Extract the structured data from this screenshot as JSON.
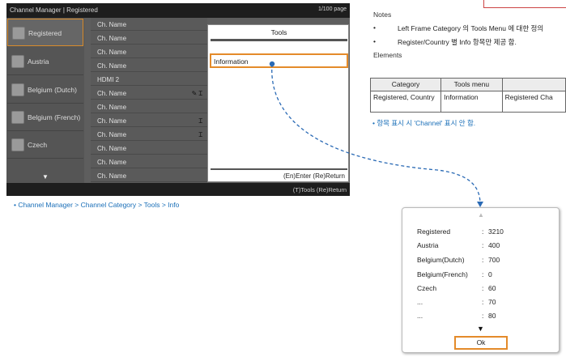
{
  "tv": {
    "title": "Channel Manager | Registered",
    "page_indicator": "1/100 page",
    "categories": [
      {
        "label": "Registered"
      },
      {
        "label": "Austria"
      },
      {
        "label": "Belgium (Dutch)"
      },
      {
        "label": "Belgium (French)"
      },
      {
        "label": "Czech"
      }
    ],
    "more_arrow": "▼",
    "channels": [
      {
        "name": "Ch. Name",
        "icons": ""
      },
      {
        "name": "Ch. Name",
        "icons": ""
      },
      {
        "name": "Ch. Name",
        "icons": ""
      },
      {
        "name": "Ch. Name",
        "icons": ""
      },
      {
        "name": "HDMI 2",
        "icons": ""
      },
      {
        "name": "Ch. Name",
        "icons": "✎ Ɪ"
      },
      {
        "name": "Ch. Name",
        "icons": ""
      },
      {
        "name": "Ch. Name",
        "icons": "Ɪ"
      },
      {
        "name": "Ch. Name",
        "icons": "Ɪ"
      },
      {
        "name": "Ch. Name",
        "icons": ""
      },
      {
        "name": "Ch. Name",
        "icons": ""
      },
      {
        "name": "Ch. Name",
        "icons": ""
      }
    ],
    "footer_keys": "(T)Tools  (Re)Return",
    "tools_popup": {
      "title": "Tools",
      "selected_item": "Information",
      "keys": "(En)Enter  (Re)Return"
    }
  },
  "caption": "• Channel Manager > Channel Category > Tools > Info",
  "notes": {
    "title": "Notes",
    "bullets": [
      "Left Frame Category 의 Tools Menu 에 대한 정의",
      "Register/Country 별  Info  항목만 제공 함."
    ]
  },
  "elements": {
    "title": "Elements",
    "table": {
      "headers": [
        "Category",
        "Tools menu",
        ""
      ],
      "rows": [
        [
          "Registered, Country",
          "Information",
          "Registered Cha"
        ]
      ]
    },
    "note": "•  항목 표시 시 'Channel' 표시 안 함."
  },
  "info_popup": {
    "up_arrow": "▲",
    "rows": [
      {
        "key": "Registered",
        "value": "3210"
      },
      {
        "key": "Austria",
        "value": "400"
      },
      {
        "key": "Belgium(Dutch)",
        "value": "700"
      },
      {
        "key": "Belgium(French)",
        "value": "0"
      },
      {
        "key": "Czech",
        "value": "60"
      },
      {
        "key": "...",
        "value": "70"
      },
      {
        "key": "...",
        "value": "80"
      }
    ],
    "separator": ":",
    "down_arrow": "▼",
    "ok_label": "Ok"
  },
  "colors": {
    "highlight": "#e48b2a",
    "link_blue": "#1a6fb8",
    "connector": "#2a6ab5"
  }
}
